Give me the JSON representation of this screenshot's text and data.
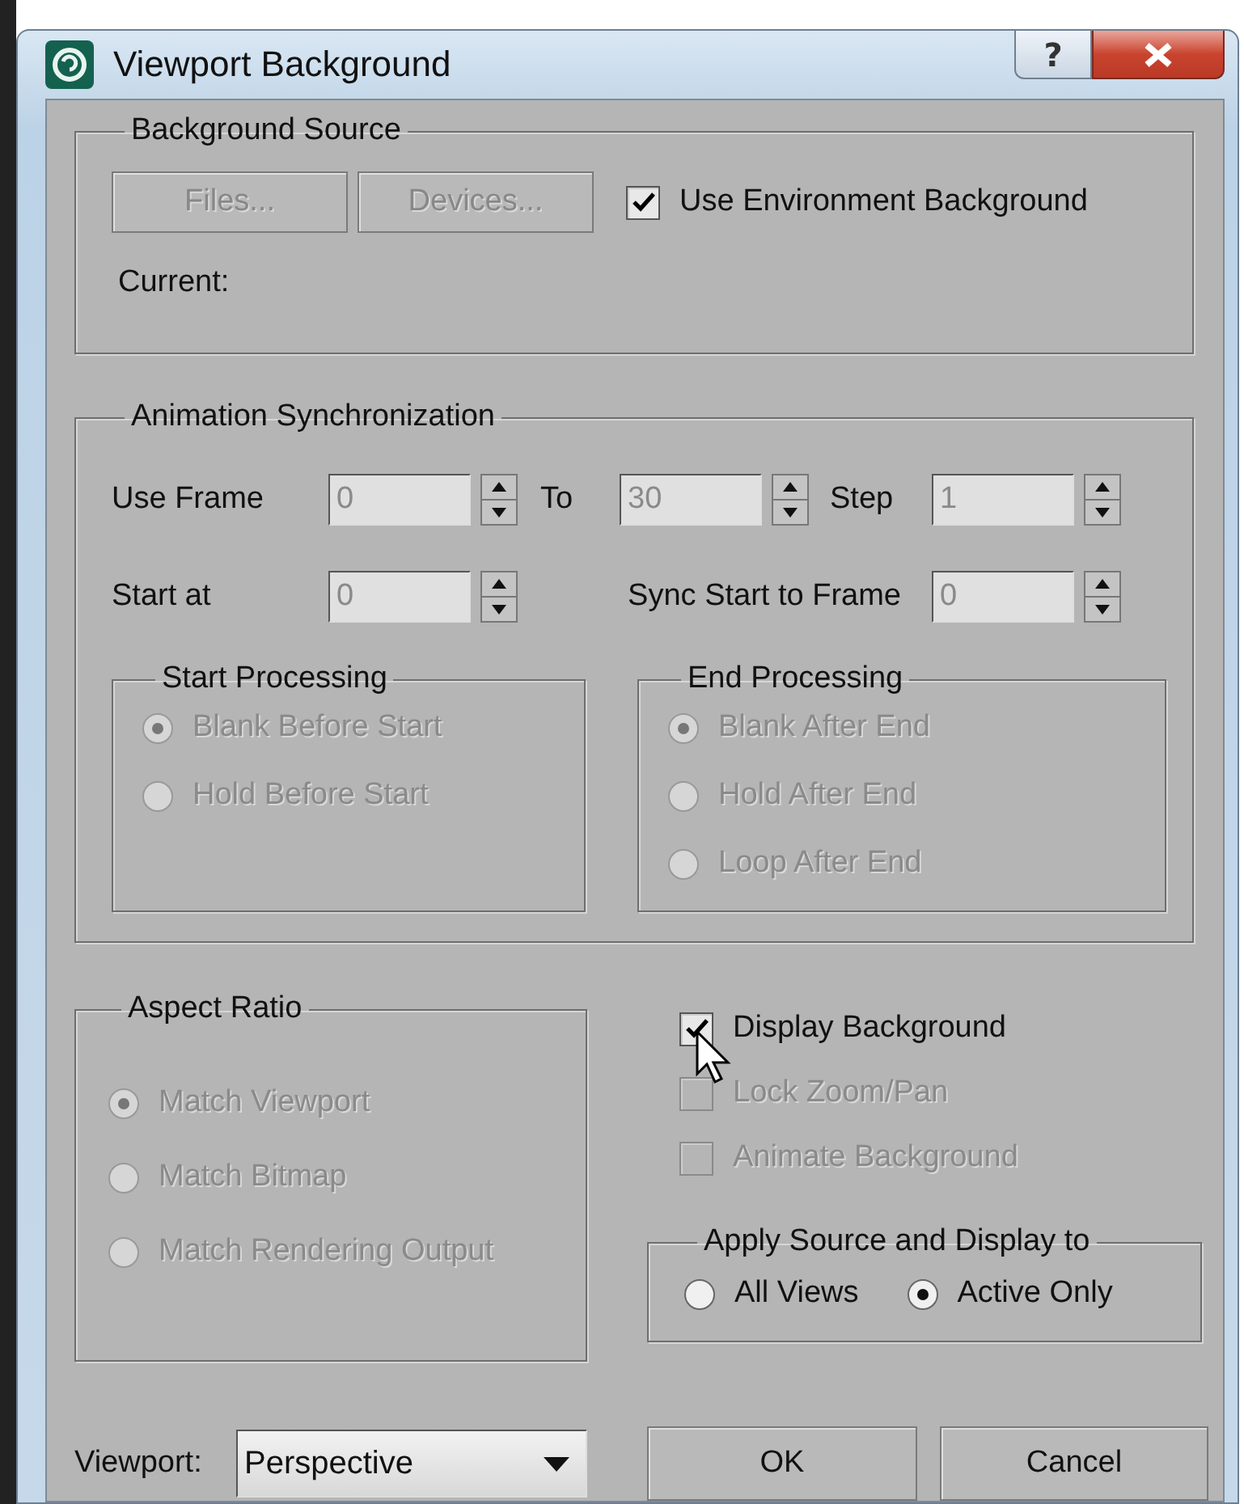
{
  "window": {
    "title": "Viewport Background",
    "help_button": "?"
  },
  "background_source": {
    "title": "Background Source",
    "buttons": [
      {
        "label": "Files...",
        "disabled": true
      },
      {
        "label": "Devices...",
        "disabled": true
      }
    ],
    "use_environment": {
      "label": "Use Environment Background",
      "checked": true
    },
    "current_label": "Current:"
  },
  "animation_sync": {
    "title": "Animation Synchronization",
    "fields": [
      {
        "label": "Use Frame",
        "value": "0",
        "disabled": true
      },
      {
        "label": "To",
        "value": "30",
        "disabled": true
      },
      {
        "label": "Step",
        "value": "1",
        "disabled": true
      },
      {
        "label": "Start at",
        "value": "0",
        "disabled": true
      },
      {
        "label": "Sync Start to Frame",
        "value": "0",
        "disabled": true
      }
    ],
    "start_processing": {
      "title": "Start Processing",
      "disabled": true,
      "options": [
        {
          "label": "Blank Before Start",
          "selected": true
        },
        {
          "label": "Hold Before Start",
          "selected": false
        }
      ]
    },
    "end_processing": {
      "title": "End Processing",
      "disabled": true,
      "options": [
        {
          "label": "Blank After End",
          "selected": true
        },
        {
          "label": "Hold After End",
          "selected": false
        },
        {
          "label": "Loop After End",
          "selected": false
        }
      ]
    }
  },
  "aspect_ratio": {
    "title": "Aspect Ratio",
    "disabled": true,
    "options": [
      {
        "label": "Match Viewport",
        "selected": true
      },
      {
        "label": "Match Bitmap",
        "selected": false
      },
      {
        "label": "Match Rendering Output",
        "selected": false
      }
    ]
  },
  "display_options": [
    {
      "label": "Display Background",
      "checked": true,
      "disabled": false
    },
    {
      "label": "Lock Zoom/Pan",
      "checked": false,
      "disabled": true
    },
    {
      "label": "Animate Background",
      "checked": false,
      "disabled": true
    }
  ],
  "apply_to": {
    "title": "Apply Source and Display to",
    "options": [
      {
        "label": "All Views",
        "selected": false
      },
      {
        "label": "Active Only",
        "selected": true
      }
    ]
  },
  "viewport": {
    "label": "Viewport:",
    "value": "Perspective"
  },
  "buttons": [
    "OK",
    "Cancel"
  ]
}
